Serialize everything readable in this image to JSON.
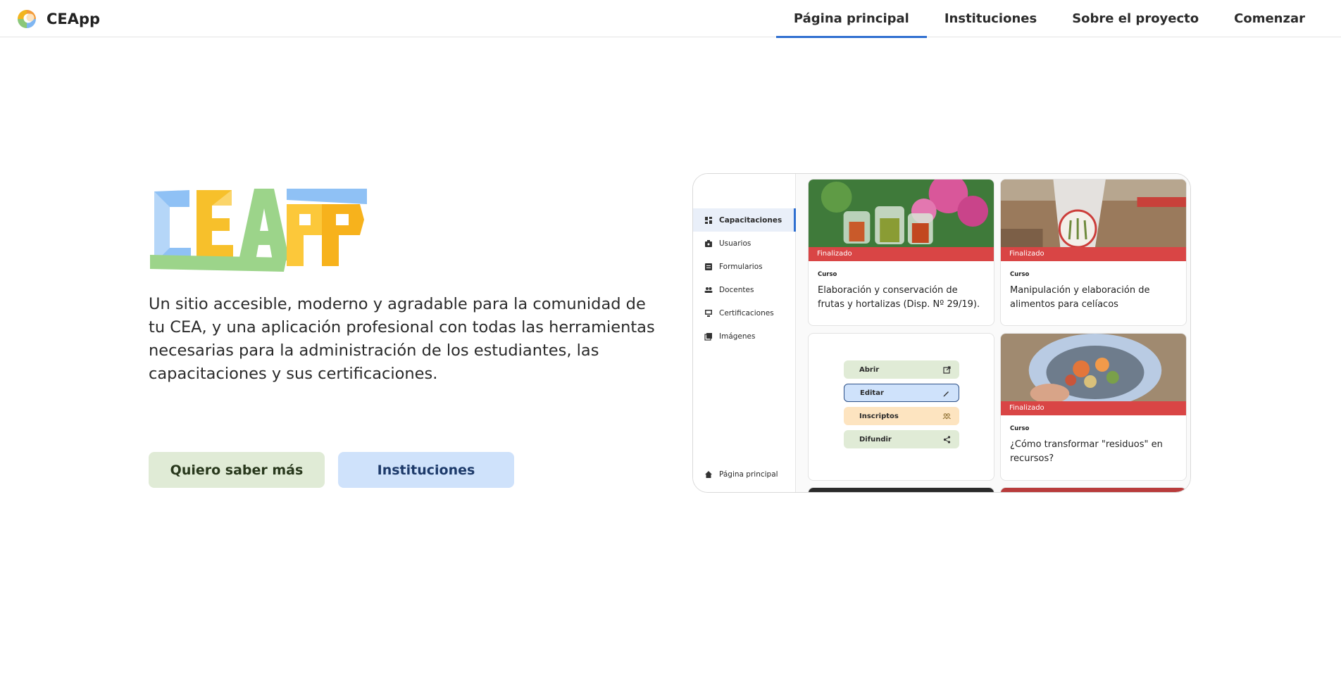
{
  "header": {
    "brand": "CEApp",
    "nav": [
      {
        "label": "Página principal",
        "active": true
      },
      {
        "label": "Instituciones",
        "active": false
      },
      {
        "label": "Sobre el proyecto",
        "active": false
      },
      {
        "label": "Comenzar",
        "active": false
      }
    ]
  },
  "hero": {
    "logo_text": "CEAPP",
    "description": "Un sitio accesible, moderno y agradable para la comunidad de tu CEA, y una aplicación profesional con todas las herramientas necesarias para la administración de los estudiantes, las capacitaciones y sus certificaciones.",
    "buttons": {
      "more": "Quiero saber más",
      "institutions": "Instituciones"
    }
  },
  "preview": {
    "sidebar": {
      "items": [
        {
          "label": "Capacitaciones",
          "icon": "dashboard-icon",
          "active": true
        },
        {
          "label": "Usuarios",
          "icon": "badge-icon",
          "active": false
        },
        {
          "label": "Formularios",
          "icon": "form-icon",
          "active": false
        },
        {
          "label": "Docentes",
          "icon": "people-icon",
          "active": false
        },
        {
          "label": "Certificaciones",
          "icon": "certificate-icon",
          "active": false
        },
        {
          "label": "Imágenes",
          "icon": "images-icon",
          "active": false
        }
      ],
      "footer": {
        "label": "Página principal",
        "icon": "home-icon"
      }
    },
    "cards": [
      {
        "status": "Finalizado",
        "kind": "Curso",
        "title": "Elaboración y conservación de frutas y hortalizas (Disp. Nº 29/19)."
      },
      {
        "status": "Finalizado",
        "kind": "Curso",
        "title": "Manipulación y elaboración de alimentos para celíacos"
      },
      {
        "status": "Finalizado",
        "kind": "Curso",
        "title": "¿Cómo transformar \"residuos\" en recursos?"
      }
    ],
    "actions": [
      "Abrir",
      "Editar",
      "Inscriptos",
      "Difundir"
    ]
  },
  "colors": {
    "accent": "#2f6fd0",
    "status_red": "#d94545",
    "green_btn": "#e0ebd6",
    "blue_btn": "#cfe2fb",
    "orange_btn": "#fde4c0"
  }
}
